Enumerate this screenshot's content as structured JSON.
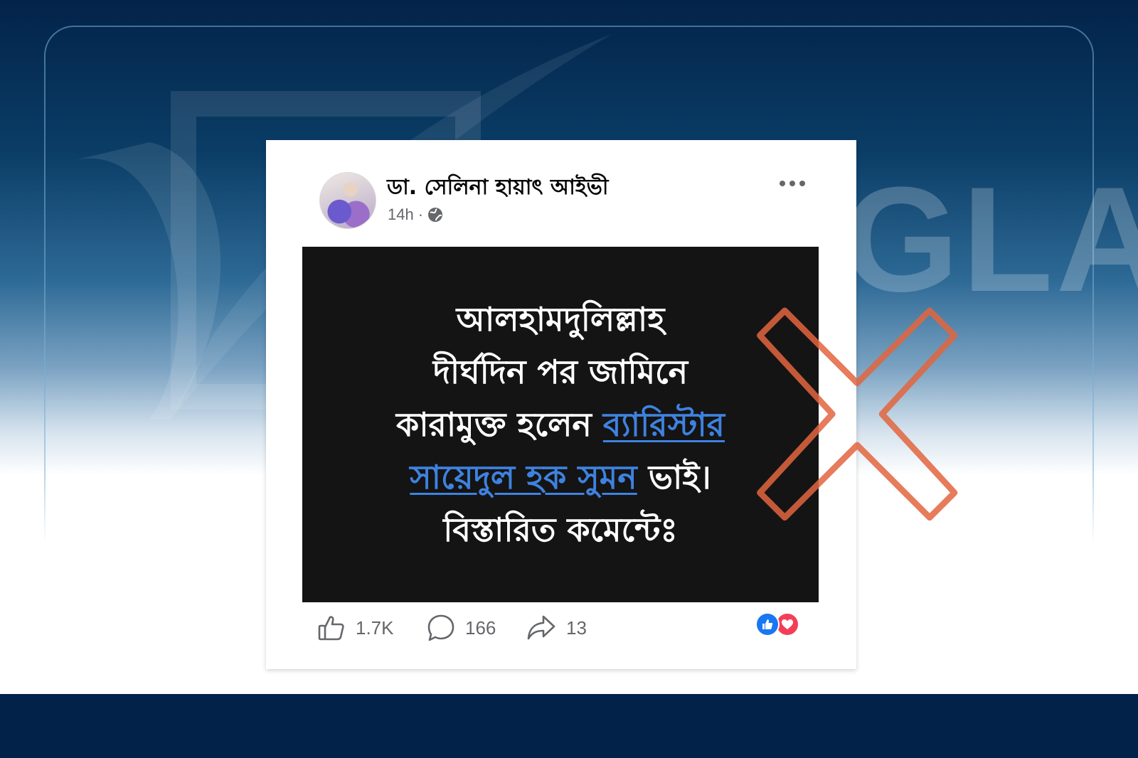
{
  "post": {
    "author_name": "ডা. সেলিনা হায়াৎ আইভী",
    "timestamp": "14h",
    "separator": "·",
    "image_text": {
      "line1": "আলহামদুলিল্লাহ",
      "line2": "দীর্ঘদিন পর জামিনে",
      "line3_plain": "কারামুক্ত হলেন ",
      "line3_link": "ব্যারিস্টার",
      "line4_link": "সায়েদুল হক সুমন",
      "line4_plain": " ভাই।",
      "line5": "বিস্তারিত কমেন্টেঃ"
    },
    "counts": {
      "likes": "1.7K",
      "comments": "166",
      "shares": "13"
    }
  },
  "icons": {
    "avatar": "profile-photo",
    "globe": "globe-icon",
    "more": "more-dots-icon",
    "like": "thumbs-up-icon",
    "comment": "comment-bubble-icon",
    "share": "share-arrow-icon",
    "reactions": [
      "like-reaction-icon",
      "love-reaction-icon"
    ],
    "overlay": "false-cross-mark"
  },
  "colors": {
    "background_dark": "#03224a",
    "link_blue": "#3e82e0",
    "cross_mark": "#e2653e",
    "like_blue": "#1877f2",
    "love_red": "#f33e58"
  }
}
